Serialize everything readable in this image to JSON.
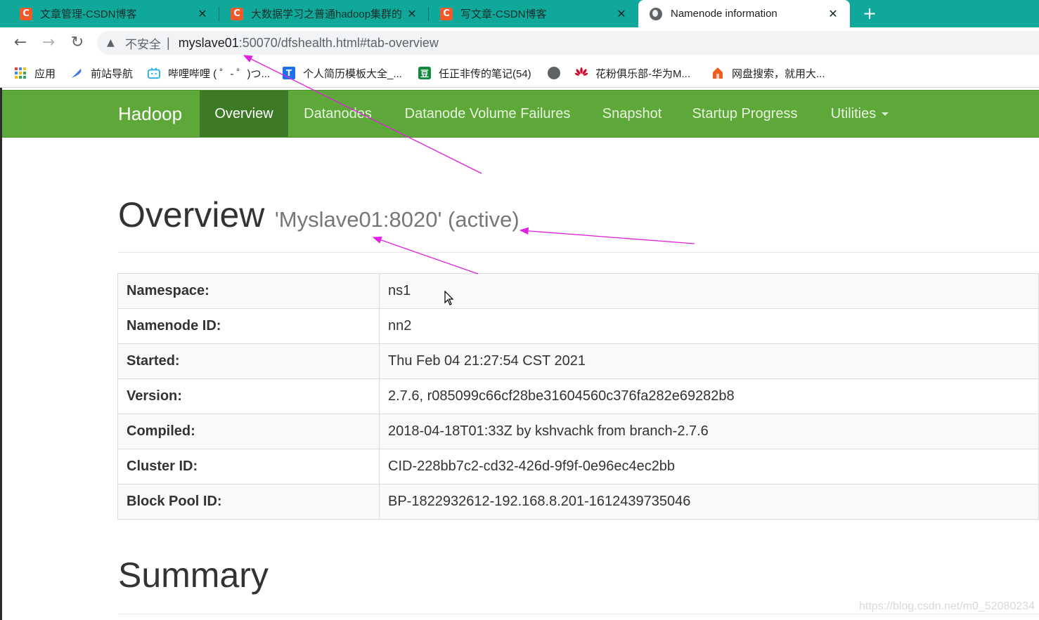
{
  "browser": {
    "tabs": [
      {
        "label": "文章管理-CSDN博客",
        "favicon": "C"
      },
      {
        "label": "大数据学习之普通hadoop集群的",
        "favicon": "C"
      },
      {
        "label": "写文章-CSDN博客",
        "favicon": "C"
      },
      {
        "label": "Namenode information",
        "favicon": "globe"
      }
    ],
    "close_glyph": "✕",
    "new_tab_glyph": "+",
    "address": {
      "security_label": "不安全",
      "separator": "|",
      "host": "myslave01",
      "path": ":50070/dfshealth.html#tab-overview"
    },
    "bookmarks": [
      {
        "label": "应用",
        "icon": "apps-grid-icon"
      },
      {
        "label": "前站导航",
        "icon": "feather-icon"
      },
      {
        "label": "哔哩哔哩 ( ゜- ゜)つ...",
        "icon": "bilibili-icon"
      },
      {
        "label": "个人简历模板大全_...",
        "icon": "resume-icon"
      },
      {
        "label": "任正非传的笔记(54)",
        "icon": "notes-icon"
      },
      {
        "label": "",
        "icon": "globe-icon"
      },
      {
        "label": "花粉俱乐部-华为M...",
        "icon": "huawei-icon"
      },
      {
        "label": "网盘搜索，就用大...",
        "icon": "cloud-search-icon"
      }
    ]
  },
  "hadoop_nav": {
    "brand": "Hadoop",
    "items": [
      "Overview",
      "Datanodes",
      "Datanode Volume Failures",
      "Snapshot",
      "Startup Progress",
      "Utilities"
    ],
    "active": "Overview"
  },
  "overview": {
    "title": "Overview",
    "subtitle": "'Myslave01:8020' (active)",
    "rows": [
      {
        "key": "Namespace:",
        "value": "ns1"
      },
      {
        "key": "Namenode ID:",
        "value": "nn2"
      },
      {
        "key": "Started:",
        "value": "Thu Feb 04 21:27:54 CST 2021"
      },
      {
        "key": "Version:",
        "value": "2.7.6, r085099c66cf28be31604560c376fa282e69282b8"
      },
      {
        "key": "Compiled:",
        "value": "2018-04-18T01:33Z by kshvachk from branch-2.7.6"
      },
      {
        "key": "Cluster ID:",
        "value": "CID-228bb7c2-cd32-426d-9f9f-0e96ec4ec2bb"
      },
      {
        "key": "Block Pool ID:",
        "value": "BP-1822932612-192.168.8.201-1612439735046"
      }
    ]
  },
  "summary": {
    "title": "Summary"
  },
  "watermark": "https://blog.csdn.net/m0_52080234",
  "colors": {
    "tab_strip": "#10a89a",
    "hadoop_green": "#5da838",
    "nav_active": "#3d7a25",
    "annotation": "#e020e0",
    "csdn": "#f1592b"
  }
}
